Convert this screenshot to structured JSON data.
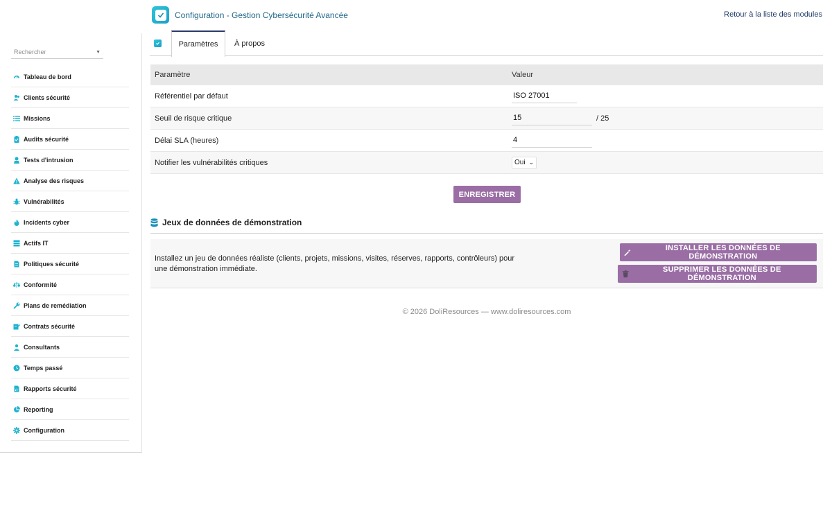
{
  "header": {
    "title": "Configuration - Gestion Cybersécurité Avancée",
    "back_link": "Retour à la liste des modules",
    "logo_icon": "shield-check-icon"
  },
  "sidebar": {
    "search_placeholder": "Rechercher",
    "items": [
      {
        "label": "Tableau de bord",
        "icon": "dashboard-icon"
      },
      {
        "label": "Clients sécurité",
        "icon": "users-icon"
      },
      {
        "label": "Missions",
        "icon": "list-icon"
      },
      {
        "label": "Audits sécurité",
        "icon": "clipboard-icon"
      },
      {
        "label": "Tests d'intrusion",
        "icon": "hacker-icon"
      },
      {
        "label": "Analyse des risques",
        "icon": "warning-icon"
      },
      {
        "label": "Vulnérabilités",
        "icon": "bug-icon"
      },
      {
        "label": "Incidents cyber",
        "icon": "fire-icon"
      },
      {
        "label": "Actifs IT",
        "icon": "server-icon"
      },
      {
        "label": "Politiques sécurité",
        "icon": "file-icon"
      },
      {
        "label": "Conformité",
        "icon": "balance-icon"
      },
      {
        "label": "Plans de remédiation",
        "icon": "wrench-icon"
      },
      {
        "label": "Contrats sécurité",
        "icon": "contract-icon"
      },
      {
        "label": "Consultants",
        "icon": "user-icon"
      },
      {
        "label": "Temps passé",
        "icon": "clock-icon"
      },
      {
        "label": "Rapports sécurité",
        "icon": "report-icon"
      },
      {
        "label": "Reporting",
        "icon": "chart-pie-icon"
      },
      {
        "label": "Configuration",
        "icon": "gear-icon"
      }
    ],
    "icon_color": "#1fb3d0"
  },
  "tabs": {
    "active": "Paramètres",
    "second": "À propos"
  },
  "params": {
    "col_param": "Paramètre",
    "col_value": "Valeur",
    "rows": [
      {
        "label": "Référentiel par défaut",
        "value": "ISO 27001"
      },
      {
        "label": "Seuil de risque critique",
        "value": "15",
        "suffix": "/ 25"
      },
      {
        "label": "Délai SLA (heures)",
        "value": "4"
      },
      {
        "label": "Notifier les vulnérabilités critiques",
        "value": "Oui"
      }
    ],
    "save_label": "ENREGISTRER"
  },
  "demo": {
    "title": "Jeux de données de démonstration",
    "description": "Installez un jeu de données réaliste (clients, projets, missions, visites, réserves, rapports, contrôleurs) pour une démonstration immédiate.",
    "install_label": "INSTALLER LES DONNÉES DE DÉMONSTRATION",
    "delete_label": "SUPPRIMER LES DONNÉES DE DÉMONSTRATION"
  },
  "footer": {
    "text": "© 2026 DoliResources — www.doliresources.com"
  },
  "colors": {
    "button": "#9a6ea5",
    "title": "#21688a",
    "accent": "#1fb3d0"
  }
}
